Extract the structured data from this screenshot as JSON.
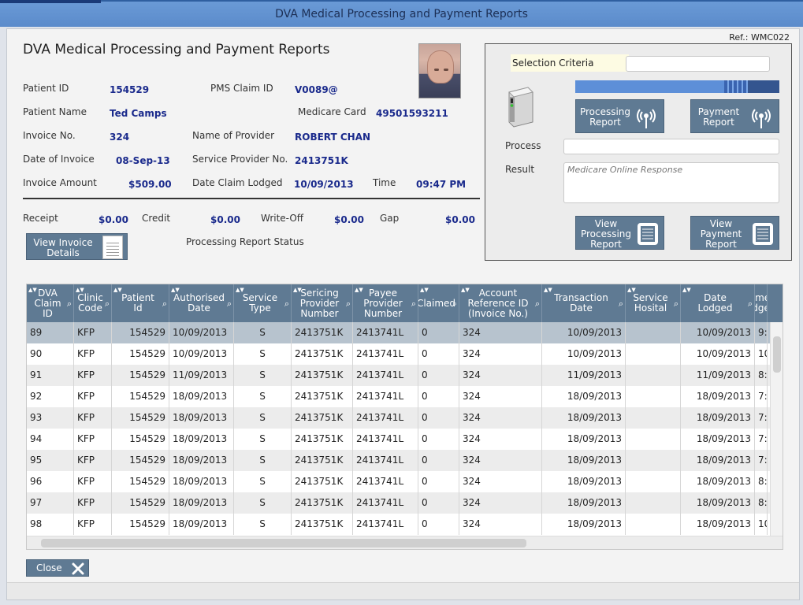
{
  "window": {
    "title": "DVA  Medical Processing and Payment Reports"
  },
  "header": {
    "ref": "Ref.: WMC022",
    "page_title": "DVA  Medical Processing and Payment Reports"
  },
  "patient": {
    "patient_id_label": "Patient ID",
    "patient_id": "154529",
    "pms_claim_label": "PMS Claim ID",
    "pms_claim": "V0089@",
    "patient_name_label": "Patient Name",
    "patient_name": "Ted Camps",
    "medicare_label": "Medicare Card",
    "medicare": "49501593211",
    "invoice_no_label": "Invoice No.",
    "invoice_no": "324",
    "provider_label": "Name of Provider",
    "provider": "ROBERT CHAN",
    "invoice_date_label": "Date of Invoice",
    "invoice_date": "08-Sep-13",
    "service_provider_label": "Service Provider No.",
    "service_provider": "2413751K",
    "invoice_amount_label": "Invoice Amount",
    "invoice_amount": "$509.00",
    "claim_lodged_label": "Date Claim Lodged",
    "claim_lodged": "10/09/2013",
    "time_label": "Time",
    "time": "09:47 PM"
  },
  "payments": {
    "receipt_label": "Receipt",
    "receipt": "$0.00",
    "credit_label": "Credit",
    "credit": "$0.00",
    "writeoff_label": "Write-Off",
    "writeoff": "$0.00",
    "gap_label": "Gap",
    "gap": "$0.00"
  },
  "actions": {
    "view_invoice_label": "View Invoice Details",
    "processing_status_label": "Processing Report Status"
  },
  "panel": {
    "selection_criteria_label": "Selection Criteria",
    "selection_criteria_value": "",
    "processing_report_label": "Processing Report",
    "payment_report_label": "Payment Report",
    "process_label": "Process",
    "process_value": "",
    "result_label": "Result",
    "result_placeholder": "Medicare Online Response",
    "view_processing_label": "View Processing Report",
    "view_payment_label": "View Payment Report"
  },
  "table": {
    "columns": [
      "DVA Claim ID",
      "Clinic Code",
      "Patient Id",
      "Authorised Date",
      "Service Type",
      "Sericing Provider Number",
      "Payee Provider Number",
      "Claimed",
      "Account Reference ID (Invoice No.)",
      "Transaction Date",
      "Service Hosital",
      "Date Lodged",
      "Time Lodged"
    ],
    "rows": [
      [
        "89",
        "KFP",
        "154529",
        "10/09/2013",
        "S",
        "2413751K",
        "2413741L",
        "0",
        "324",
        "10/09/2013",
        "",
        "10/09/2013",
        "9:"
      ],
      [
        "90",
        "KFP",
        "154529",
        "10/09/2013",
        "S",
        "2413751K",
        "2413741L",
        "0",
        "324",
        "10/09/2013",
        "",
        "10/09/2013",
        "10"
      ],
      [
        "91",
        "KFP",
        "154529",
        "11/09/2013",
        "S",
        "2413751K",
        "2413741L",
        "0",
        "324",
        "11/09/2013",
        "",
        "11/09/2013",
        "8:"
      ],
      [
        "92",
        "KFP",
        "154529",
        "18/09/2013",
        "S",
        "2413751K",
        "2413741L",
        "0",
        "324",
        "18/09/2013",
        "",
        "18/09/2013",
        "7:"
      ],
      [
        "93",
        "KFP",
        "154529",
        "18/09/2013",
        "S",
        "2413751K",
        "2413741L",
        "0",
        "324",
        "18/09/2013",
        "",
        "18/09/2013",
        "7:"
      ],
      [
        "94",
        "KFP",
        "154529",
        "18/09/2013",
        "S",
        "2413751K",
        "2413741L",
        "0",
        "324",
        "18/09/2013",
        "",
        "18/09/2013",
        "7:"
      ],
      [
        "95",
        "KFP",
        "154529",
        "18/09/2013",
        "S",
        "2413751K",
        "2413741L",
        "0",
        "324",
        "18/09/2013",
        "",
        "18/09/2013",
        "7:"
      ],
      [
        "96",
        "KFP",
        "154529",
        "18/09/2013",
        "S",
        "2413751K",
        "2413741L",
        "0",
        "324",
        "18/09/2013",
        "",
        "18/09/2013",
        "8:"
      ],
      [
        "97",
        "KFP",
        "154529",
        "18/09/2013",
        "S",
        "2413751K",
        "2413741L",
        "0",
        "324",
        "18/09/2013",
        "",
        "18/09/2013",
        "8:"
      ],
      [
        "98",
        "KFP",
        "154529",
        "18/09/2013",
        "S",
        "2413751K",
        "2413741L",
        "0",
        "324",
        "18/09/2013",
        "",
        "18/09/2013",
        "10"
      ]
    ],
    "selected_row": 0
  },
  "footer": {
    "close_label": "Close"
  },
  "colors": {
    "accent": "#5f7a93",
    "value_text": "#1a2a8c",
    "title_bar": "#6a9ad6"
  },
  "icons": [
    "document-icon",
    "wireless-icon",
    "report-icon",
    "close-x-icon",
    "search-icon",
    "card-reader-icon"
  ]
}
